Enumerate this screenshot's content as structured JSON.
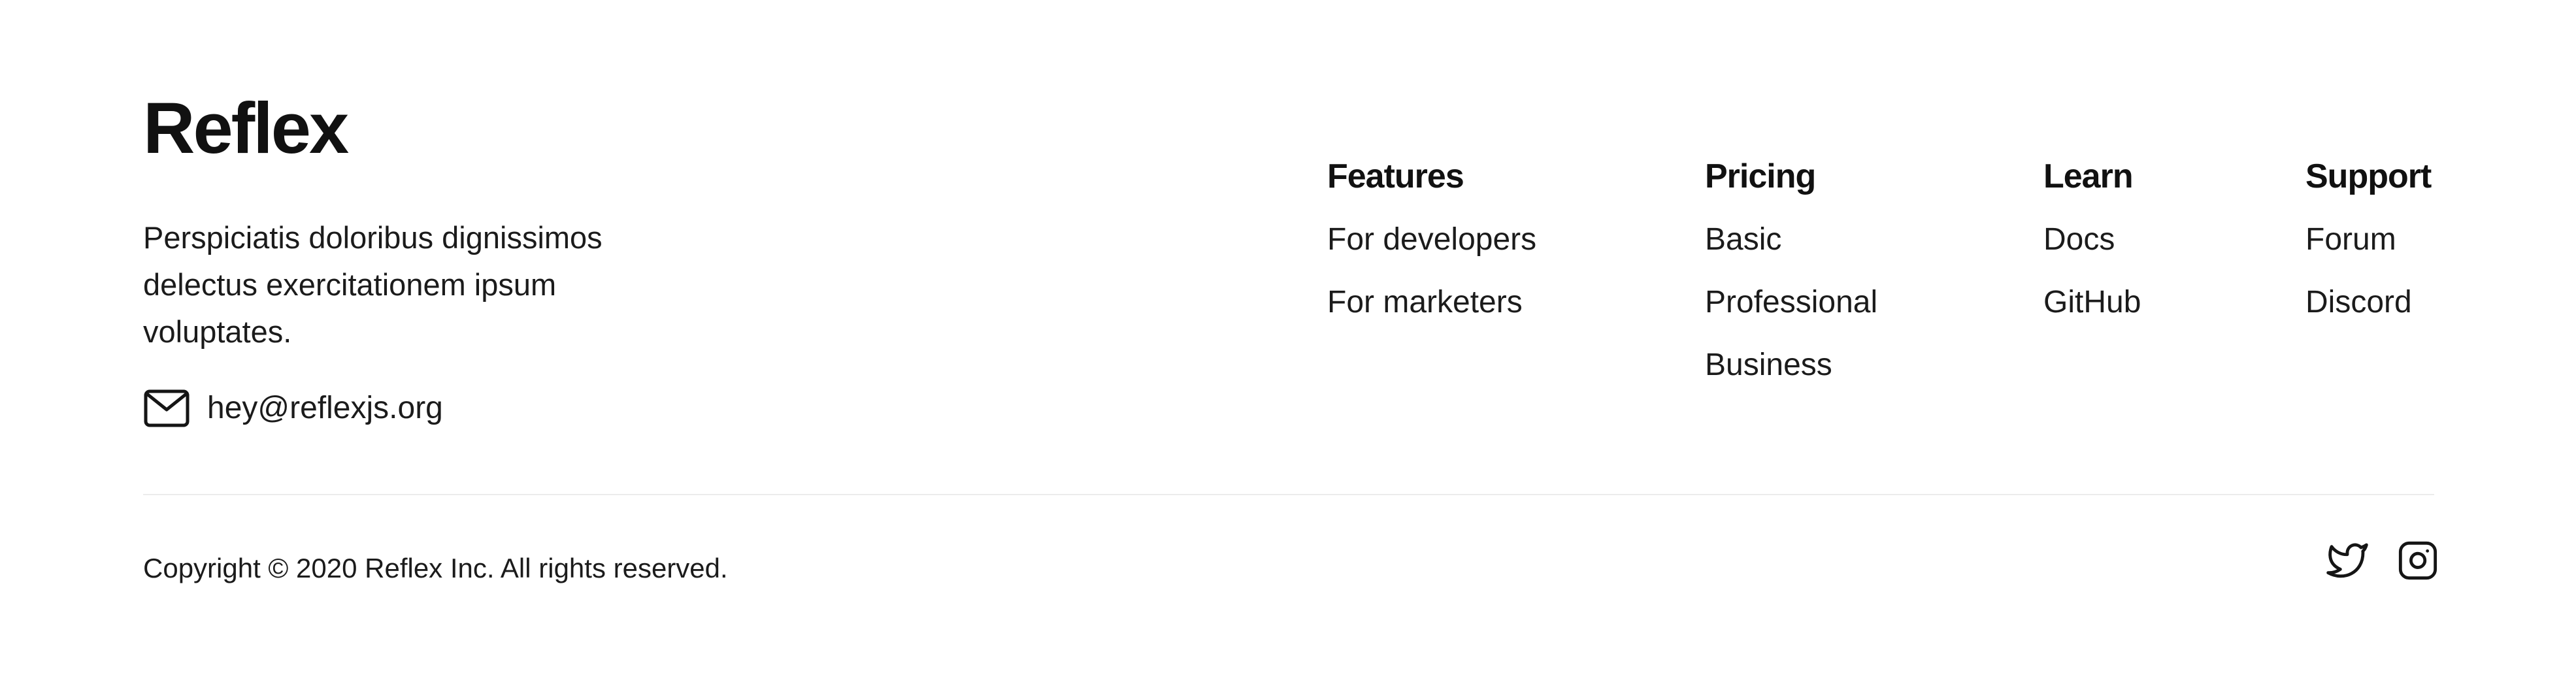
{
  "brand": {
    "name": "Reflex"
  },
  "about": {
    "description_lines": [
      "Perspiciatis doloribus dignissimos",
      "delectus exercitationem ipsum",
      "voluptates."
    ],
    "email": "hey@reflexjs.org",
    "email_icon": "mail-icon"
  },
  "columns": [
    {
      "title": "Features",
      "links": [
        "For developers",
        "For marketers"
      ]
    },
    {
      "title": "Pricing",
      "links": [
        "Basic",
        "Professional",
        "Business"
      ]
    },
    {
      "title": "Learn",
      "links": [
        "Docs",
        "GitHub"
      ]
    },
    {
      "title": "Support",
      "links": [
        "Forum",
        "Discord"
      ]
    }
  ],
  "bottom": {
    "copyright": "Copyright © 2020 Reflex Inc. All rights reserved.",
    "social_icons": [
      "twitter-icon",
      "instagram-icon"
    ]
  },
  "colors": {
    "text": "#151515",
    "divider": "#ececec",
    "background": "#ffffff"
  }
}
